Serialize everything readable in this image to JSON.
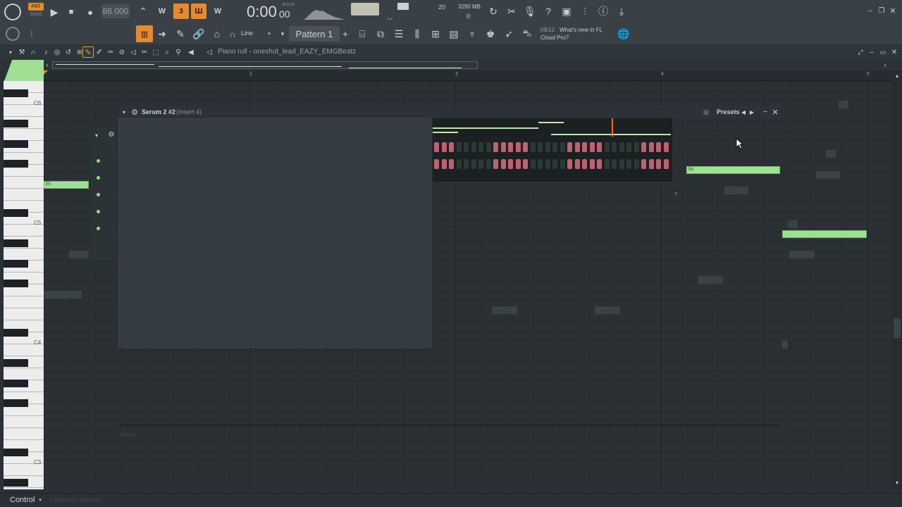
{
  "toolbar": {
    "pat_label": "PAT",
    "song_label": "SONG",
    "tempo": "86.000",
    "time": "0:00",
    "time_small": "00",
    "time_unit": "M:S:CS",
    "cpu_value": "20",
    "ram_value": "3290 MB",
    "poly_value": "0",
    "snap_mode": "Line",
    "pattern_name": "Pattern 1",
    "news_date": "09/12",
    "news_text_1": "What's new in FL",
    "news_text_2": "Cloud Pro?"
  },
  "piano_roll": {
    "title": "Piano roll - oneshot_lead_EAZY_EMGBeatz",
    "bar_numbers": [
      "2",
      "3",
      "4",
      "5"
    ],
    "key_labels": [
      "C6",
      "C5",
      "C4",
      "C3"
    ],
    "note_labels": [
      "E5",
      "B4"
    ]
  },
  "plugin": {
    "title": "Serum 2 #2",
    "insert": "(Insert 4)",
    "presets_label": "Presets",
    "inner_label": "Serum"
  },
  "bottom": {
    "control_label": "Control",
    "control_value": "Channel volume"
  },
  "colors": {
    "accent_orange": "#e48b2f",
    "note_green": "#9fdf94",
    "playhead": "#ff6a2a",
    "pad_red": "#c06070"
  }
}
